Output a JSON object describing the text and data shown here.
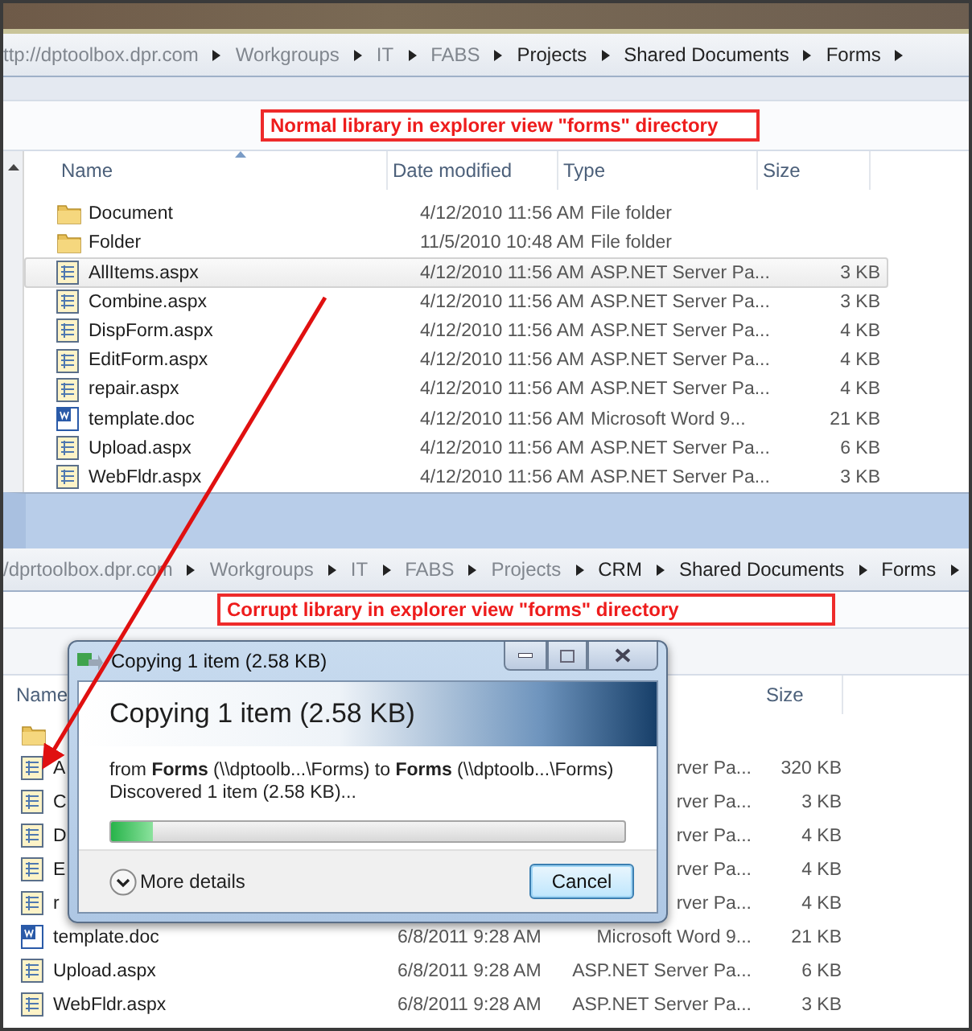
{
  "top_window": {
    "address_bar": {
      "crumbs": [
        {
          "label": "ttp://dptoolbox.dpr.com",
          "blurred": true
        },
        {
          "label": "Workgroups",
          "blurred": true
        },
        {
          "label": "IT",
          "blurred": true
        },
        {
          "label": "FABS",
          "blurred": true
        },
        {
          "label": "Projects",
          "blurred": false
        },
        {
          "label": "Shared Documents",
          "blurred": false
        },
        {
          "label": "Forms",
          "blurred": false
        }
      ]
    },
    "annotation": "Normal library in explorer view \"forms\" directory",
    "columns": [
      "Name",
      "Date modified",
      "Type",
      "Size"
    ],
    "rows": [
      {
        "kind": "folder",
        "name": "Document",
        "date": "4/12/2010 11:56 AM",
        "type": "File folder",
        "selected": false
      },
      {
        "kind": "folder",
        "name": "Folder",
        "date": "11/5/2010 10:48 AM",
        "type": "File folder",
        "selected": false
      },
      {
        "kind": "page",
        "name": "AllItems.aspx",
        "date": "4/12/2010 11:56 AM",
        "type": "ASP.NET Server Pa...",
        "size": "3 KB",
        "selected": true
      },
      {
        "kind": "page",
        "name": "Combine.aspx",
        "date": "4/12/2010 11:56 AM",
        "type": "ASP.NET Server Pa...",
        "size": "3 KB",
        "selected": false
      },
      {
        "kind": "page",
        "name": "DispForm.aspx",
        "date": "4/12/2010 11:56 AM",
        "type": "ASP.NET Server Pa...",
        "size": "4 KB",
        "selected": false
      },
      {
        "kind": "page",
        "name": "EditForm.aspx",
        "date": "4/12/2010 11:56 AM",
        "type": "ASP.NET Server Pa...",
        "size": "4 KB",
        "selected": false
      },
      {
        "kind": "page",
        "name": "repair.aspx",
        "date": "4/12/2010 11:56 AM",
        "type": "ASP.NET Server Pa...",
        "size": "4 KB",
        "selected": false
      },
      {
        "kind": "word",
        "name": "template.doc",
        "date": "4/12/2010 11:56 AM",
        "type": "Microsoft Word 9...",
        "size": "21 KB",
        "selected": false
      },
      {
        "kind": "page",
        "name": "Upload.aspx",
        "date": "4/12/2010 11:56 AM",
        "type": "ASP.NET Server Pa...",
        "size": "6 KB",
        "selected": false
      },
      {
        "kind": "page",
        "name": "WebFldr.aspx",
        "date": "4/12/2010 11:56 AM",
        "type": "ASP.NET Server Pa...",
        "size": "3 KB",
        "selected": false
      }
    ]
  },
  "bottom_window": {
    "address_bar": {
      "crumbs": [
        {
          "label": "/dprtoolbox.dpr.com",
          "blurred": true
        },
        {
          "label": "Workgroups",
          "blurred": true
        },
        {
          "label": "IT",
          "blurred": true
        },
        {
          "label": "FABS",
          "blurred": true
        },
        {
          "label": "Projects",
          "blurred": true
        },
        {
          "label": "CRM",
          "blurred": false
        },
        {
          "label": "Shared Documents",
          "blurred": false
        },
        {
          "label": "Forms",
          "blurred": false
        }
      ]
    },
    "annotation": "Corrupt library in explorer view \"forms\" directory",
    "columns": [
      "Name",
      "Size"
    ],
    "rows": [
      {
        "kind": "folder"
      },
      {
        "kind": "page",
        "name": "A",
        "type": "rver Pa...",
        "size": "320 KB"
      },
      {
        "kind": "page",
        "name": "C",
        "type": "rver Pa...",
        "size": "3 KB"
      },
      {
        "kind": "page",
        "name": "D",
        "type": "rver Pa...",
        "size": "4 KB"
      },
      {
        "kind": "page",
        "name": "E",
        "type": "rver Pa...",
        "size": "4 KB"
      },
      {
        "kind": "page",
        "name": "r",
        "type": "rver Pa...",
        "size": "4 KB"
      },
      {
        "kind": "word",
        "name": "template.doc",
        "date": "6/8/2011 9:28 AM",
        "type": "Microsoft Word 9...",
        "size": "21 KB"
      },
      {
        "kind": "page",
        "name": "Upload.aspx",
        "date": "6/8/2011 9:28 AM",
        "type": "ASP.NET Server Pa...",
        "size": "6 KB"
      },
      {
        "kind": "page",
        "name": "WebFldr.aspx",
        "date": "6/8/2011 9:28 AM",
        "type": "ASP.NET Server Pa...",
        "size": "3 KB"
      }
    ]
  },
  "copy_dialog": {
    "title": "Copying 1 item (2.58 KB)",
    "heading": "Copying 1 item (2.58 KB)",
    "source": "from **Forms** (\\\\dptoolb...\\Forms)  to **Forms** (\\\\dptoolb...\\Forms)",
    "status": "Discovered 1 item (2.58 KB)...",
    "progress": {
      "level": 0.08
    },
    "more_details": "More details",
    "cancel": "Cancel"
  }
}
